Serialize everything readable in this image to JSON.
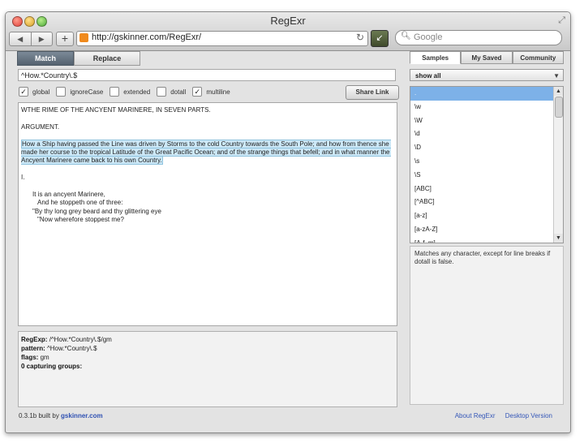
{
  "window": {
    "title": "RegExr"
  },
  "toolbar": {
    "back_label": "◀",
    "forward_label": "▶",
    "new_tab_label": "+",
    "url": "http://gskinner.com/RegExr/",
    "search_placeholder": "Google"
  },
  "left": {
    "tabs": [
      {
        "label": "Match",
        "active": true
      },
      {
        "label": "Replace",
        "active": false
      }
    ],
    "pattern": "^How.*Country\\.$",
    "flags": [
      {
        "label": "global",
        "checked": true
      },
      {
        "label": "ignoreCase",
        "checked": false
      },
      {
        "label": "extended",
        "checked": false
      },
      {
        "label": "dotall",
        "checked": false
      },
      {
        "label": "multiline",
        "checked": true
      }
    ],
    "share_label": "Share Link",
    "text": {
      "line1": "WTHE RIME OF THE ANCYENT MARINERE, IN SEVEN PARTS.",
      "line2": "ARGUMENT.",
      "match": "How a Ship having passed the Line was driven by Storms to the cold Country towards the South Pole; and how from thence she made her course to the tropical Latitude of the Great Pacific Ocean; and of the strange things that befell; and in what manner the Ancyent Marinere came back to his own Country.",
      "line4": "I.",
      "poem1": "It is an ancyent Marinere,",
      "poem2": "And he stoppeth one of three:",
      "poem3": "\"By thy long grey beard and thy glittering eye",
      "poem4": "\"Now wherefore stoppest me?"
    },
    "results": {
      "regexp_label": "RegExp:",
      "regexp_value": "/^How.*Country\\.$/gm",
      "pattern_label": "pattern:",
      "pattern_value": "^How.*Country\\.$",
      "flags_label": "flags:",
      "flags_value": "gm",
      "groups": "0 capturing groups:"
    }
  },
  "right": {
    "tabs": [
      {
        "label": "Samples",
        "active": true
      },
      {
        "label": "My Saved",
        "active": false
      },
      {
        "label": "Community",
        "active": false
      }
    ],
    "filter": "show all",
    "items": [
      ".",
      "\\w",
      "\\W",
      "\\d",
      "\\D",
      "\\s",
      "\\S",
      "[ABC]",
      "[^ABC]",
      "[a-z]",
      "[a-zA-Z]",
      "[A-f_m]"
    ],
    "description": "Matches any character, except for line breaks if dotall is false."
  },
  "footer": {
    "version": "0.3.1b built by",
    "author": "gskinner.com",
    "about": "About RegExr",
    "desktop": "Desktop Version"
  }
}
